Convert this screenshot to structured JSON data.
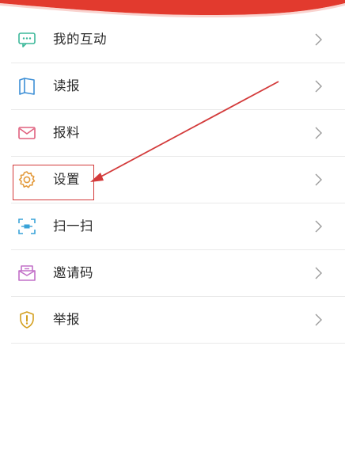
{
  "colors": {
    "banner": "#e23a2e",
    "annotation": "#d33a3a",
    "text": "#2a2a2a",
    "divider": "#e9e9e9",
    "chevron": "#9a9a9a"
  },
  "menu": {
    "items": [
      {
        "label": "我的互动",
        "icon": "chat-bubble-icon",
        "icon_color": "#3db89a"
      },
      {
        "label": "读报",
        "icon": "book-icon",
        "icon_color": "#3d8fd6"
      },
      {
        "label": "报料",
        "icon": "envelope-icon",
        "icon_color": "#e0607e"
      },
      {
        "label": "设置",
        "icon": "gear-icon",
        "icon_color": "#e39a3c"
      },
      {
        "label": "扫一扫",
        "icon": "scan-icon",
        "icon_color": "#3aa3d8"
      },
      {
        "label": "邀请码",
        "icon": "inbox-icon",
        "icon_color": "#c270c8"
      },
      {
        "label": "举报",
        "icon": "shield-alert-icon",
        "icon_color": "#d4a020"
      }
    ]
  },
  "annotation": {
    "highlighted_item": "设置"
  }
}
